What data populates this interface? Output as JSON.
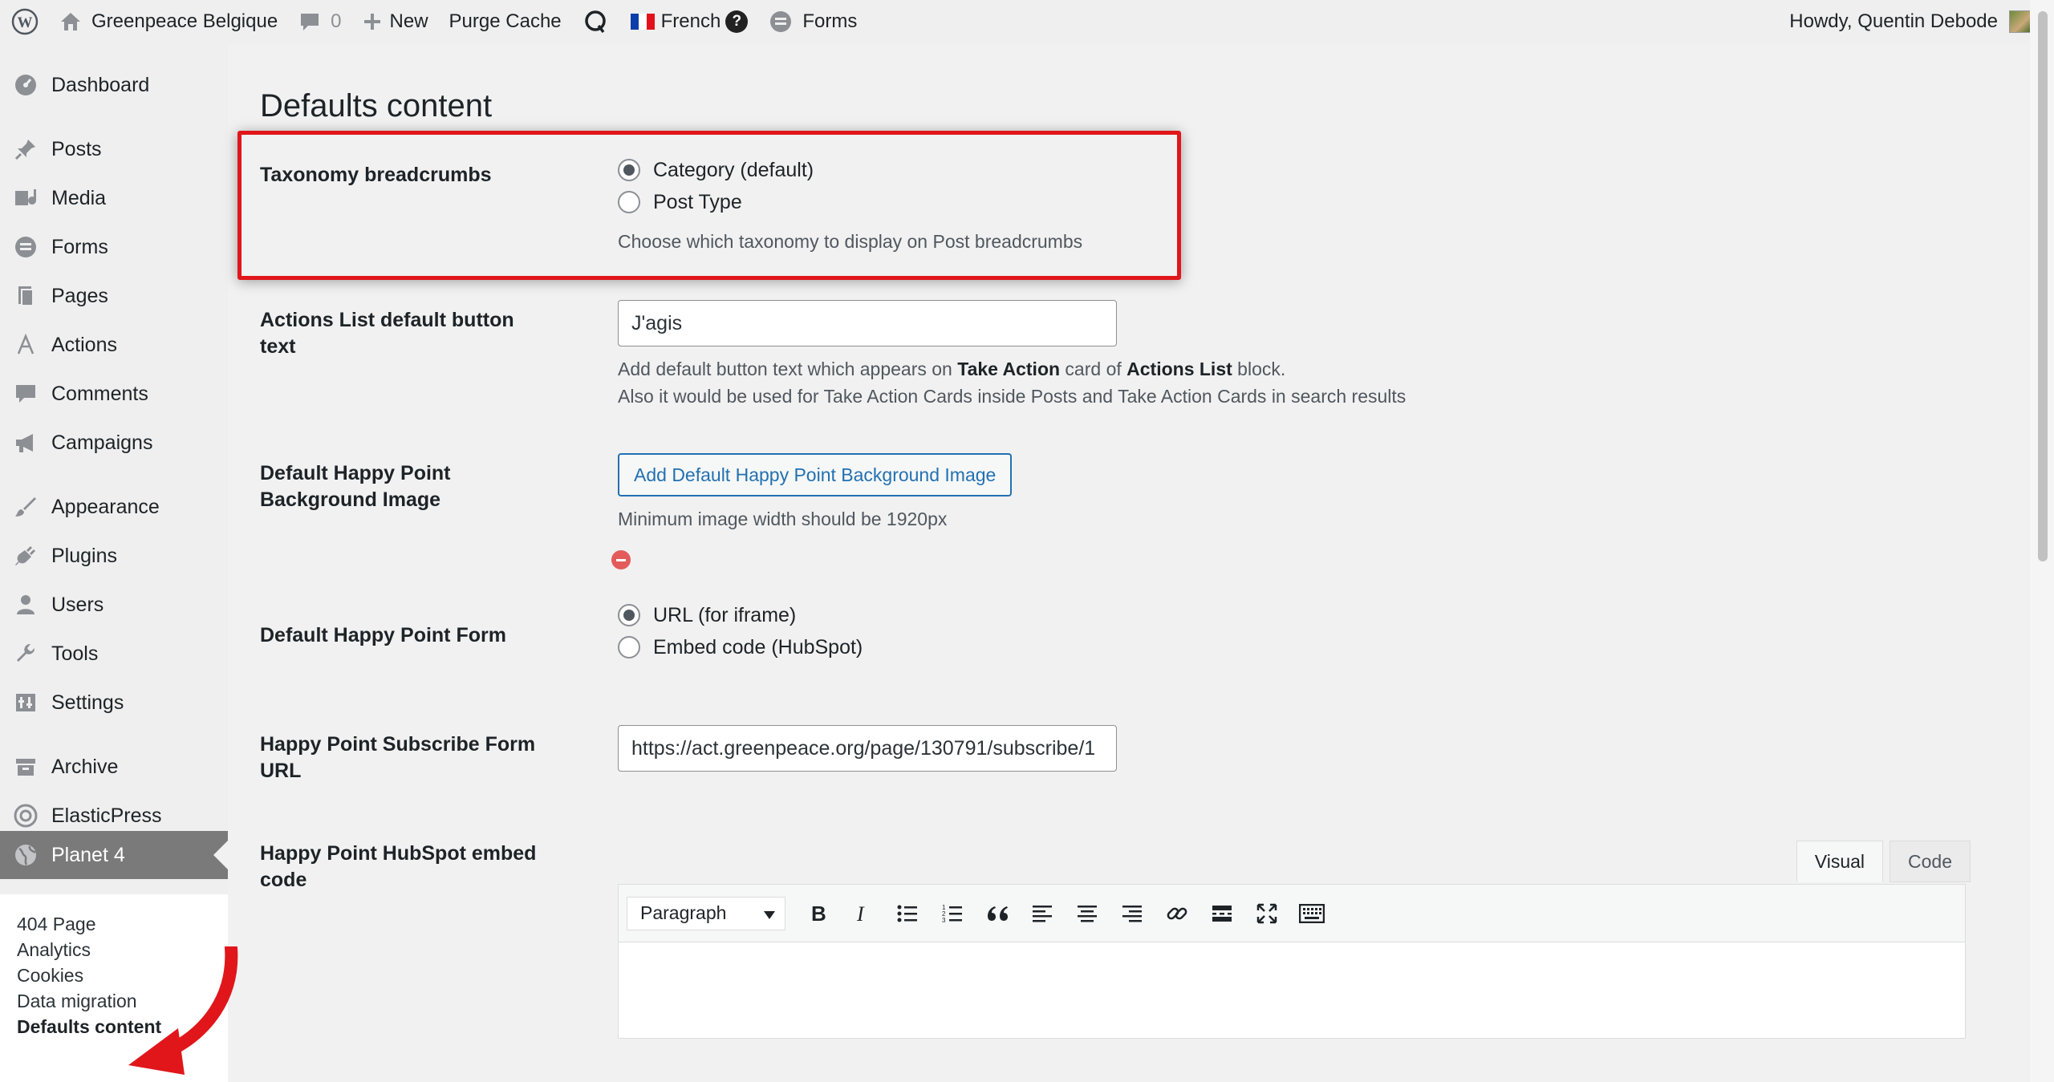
{
  "adminbar": {
    "site_name": "Greenpeace Belgique",
    "comments_count": "0",
    "new_label": "New",
    "purge_cache_label": "Purge Cache",
    "language_label": "French",
    "help_label": "?",
    "forms_label": "Forms",
    "howdy": "Howdy, Quentin Debode"
  },
  "sidebar": {
    "items": [
      {
        "label": "Dashboard",
        "icon": "dashboard-icon"
      },
      {
        "label": "Posts",
        "icon": "pin-icon"
      },
      {
        "label": "Media",
        "icon": "media-icon"
      },
      {
        "label": "Forms",
        "icon": "forms-icon"
      },
      {
        "label": "Pages",
        "icon": "pages-icon"
      },
      {
        "label": "Actions",
        "icon": "actions-icon"
      },
      {
        "label": "Comments",
        "icon": "comments-icon"
      },
      {
        "label": "Campaigns",
        "icon": "megaphone-icon"
      },
      {
        "label": "Appearance",
        "icon": "brush-icon"
      },
      {
        "label": "Plugins",
        "icon": "plugin-icon"
      },
      {
        "label": "Users",
        "icon": "user-icon"
      },
      {
        "label": "Tools",
        "icon": "wrench-icon"
      },
      {
        "label": "Settings",
        "icon": "settings-icon"
      },
      {
        "label": "Archive",
        "icon": "archive-icon"
      },
      {
        "label": "ElasticPress",
        "icon": "elasticpress-icon"
      },
      {
        "label": "Planet 4",
        "icon": "globe-icon"
      }
    ],
    "submenu": [
      "404 Page",
      "Analytics",
      "Cookies",
      "Data migration",
      "Defaults content"
    ]
  },
  "main": {
    "title": "Defaults content",
    "taxonomy": {
      "label": "Taxonomy breadcrumbs",
      "options": [
        "Category (default)",
        "Post Type"
      ],
      "selected": "Category (default)",
      "description": "Choose which taxonomy to display on Post breadcrumbs"
    },
    "actions_list": {
      "label": "Actions List default button text",
      "value": "J'agis",
      "desc_prefix": "Add default button text which appears on ",
      "desc_bold1": "Take Action",
      "desc_mid": " card of ",
      "desc_bold2": "Actions List",
      "desc_suffix": " block.",
      "desc_line2": "Also it would be used for Take Action Cards inside Posts and Take Action Cards in search results"
    },
    "happy_point_bg": {
      "label": "Default Happy Point Background Image",
      "button": "Add Default Happy Point Background Image",
      "description": "Minimum image width should be 1920px"
    },
    "happy_point_form": {
      "label": "Default Happy Point Form",
      "options": [
        "URL (for iframe)",
        "Embed code (HubSpot)"
      ],
      "selected": "URL (for iframe)"
    },
    "subscribe_url": {
      "label": "Happy Point Subscribe Form URL",
      "value": "https://act.greenpeace.org/page/130791/subscribe/1"
    },
    "hubspot": {
      "label": "Happy Point HubSpot embed code",
      "tabs": [
        "Visual",
        "Code"
      ],
      "active_tab": "Visual",
      "format": "Paragraph"
    }
  },
  "colors": {
    "highlight": "#e0161b",
    "accent": "#2271b1",
    "current_menu": "#7a7a7a"
  }
}
